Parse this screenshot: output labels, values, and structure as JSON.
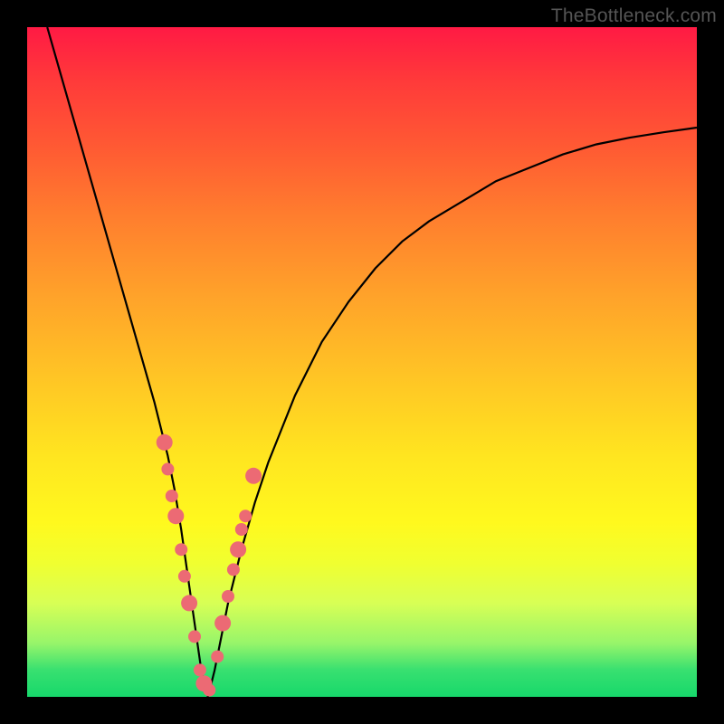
{
  "watermark": "TheBottleneck.com",
  "colors": {
    "background": "#000000",
    "gradient_top": "#ff1a44",
    "gradient_bottom": "#17d86b",
    "curve": "#000000",
    "markers": "#ec6a74"
  },
  "chart_data": {
    "type": "line",
    "title": "",
    "xlabel": "",
    "ylabel": "",
    "xlim": [
      0,
      100
    ],
    "ylim": [
      0,
      100
    ],
    "grid": false,
    "legend": false,
    "annotations": [
      "TheBottleneck.com"
    ],
    "series": [
      {
        "name": "bottleneck-curve",
        "type": "line",
        "x": [
          3,
          5,
          7,
          9,
          11,
          13,
          15,
          17,
          19,
          21,
          22,
          23,
          24,
          25,
          26,
          27,
          28,
          30,
          32,
          34,
          36,
          38,
          40,
          44,
          48,
          52,
          56,
          60,
          65,
          70,
          75,
          80,
          85,
          90,
          95,
          100
        ],
        "values": [
          100,
          93,
          86,
          79,
          72,
          65,
          58,
          51,
          44,
          36,
          31,
          25,
          18,
          11,
          4,
          0,
          4,
          14,
          22,
          29,
          35,
          40,
          45,
          53,
          59,
          64,
          68,
          71,
          74,
          77,
          79,
          81,
          82.5,
          83.5,
          84.3,
          85
        ]
      },
      {
        "name": "bottleneck-markers",
        "type": "scatter",
        "x": [
          20.5,
          21.0,
          21.6,
          22.2,
          23.0,
          23.5,
          24.2,
          25.0,
          25.8,
          26.4,
          27.2,
          28.4,
          29.2,
          30.0,
          30.8,
          31.5,
          32.0,
          32.6,
          33.8
        ],
        "values": [
          38,
          34,
          30,
          27,
          22,
          18,
          14,
          9,
          4,
          2,
          1,
          6,
          11,
          15,
          19,
          22,
          25,
          27,
          33
        ]
      }
    ]
  }
}
